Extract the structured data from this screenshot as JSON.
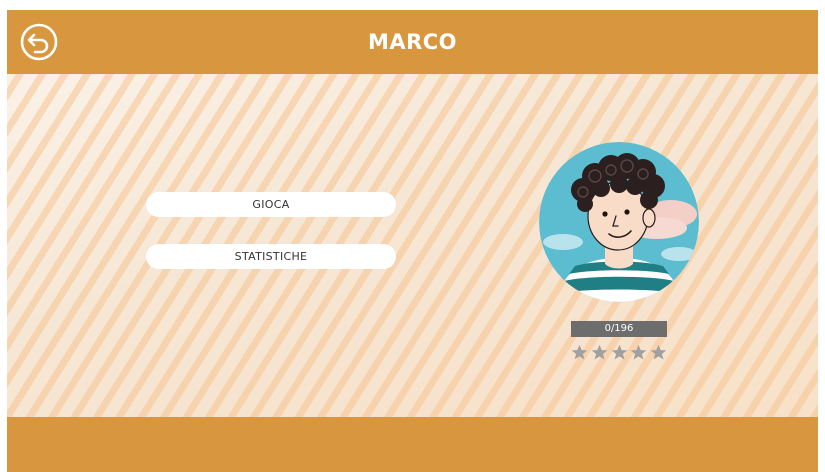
{
  "header": {
    "title": "MARCO",
    "back_icon": "back-arrow-circle-icon"
  },
  "menu": {
    "play_label": "GIOCA",
    "stats_label": "STATISTICHE"
  },
  "profile": {
    "avatar": "boy-curly-hair-avatar",
    "progress_text": "0/196",
    "progress_value": 0,
    "progress_total": 196,
    "stars_total": 5,
    "stars_filled": 0,
    "star_icon": "star-icon"
  },
  "colors": {
    "header_bg": "#d8963f",
    "footer_bg": "#d8963f",
    "main_bg": "#f6e6d3",
    "stripe": "#f7c491",
    "progress_bg": "#6d6d6d",
    "star_empty": "#a0a0a0"
  }
}
